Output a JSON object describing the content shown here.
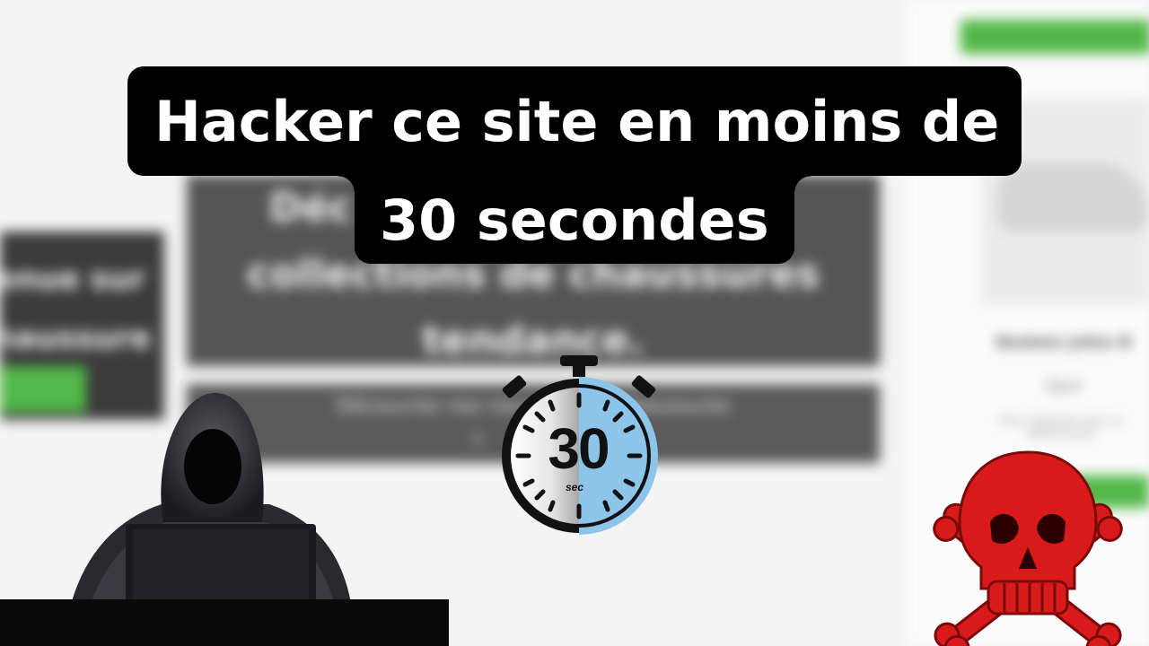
{
  "title": {
    "line1": "Hacker ce site en moins de",
    "line2": "30 secondes"
  },
  "background_site": {
    "left_panel_lines": [
      "venue sur",
      "chaussure"
    ],
    "main_panel_lines": [
      "Déc",
      "collections de chaussures",
      "tendance."
    ],
    "sub_panel_lines": [
      "Découvrez nos nouvelles  de chaussures",
      "t"
    ],
    "right_product": {
      "name_line1": "Baskets jolies B",
      "name_line2": "ligue",
      "description": "Pour intégrant avec un déplacement"
    }
  },
  "timer": {
    "value": "30",
    "unit": "sec",
    "remaining_fraction": 0.5
  },
  "icons": [
    "hooded-hacker-icon",
    "stopwatch-icon",
    "skull-crossbones-icon"
  ],
  "colors": {
    "banner_bg": "#000000",
    "banner_text": "#ffffff",
    "timer_accent": "#8cc4ea",
    "skull_red": "#d91a1a",
    "site_green": "#52b848"
  }
}
